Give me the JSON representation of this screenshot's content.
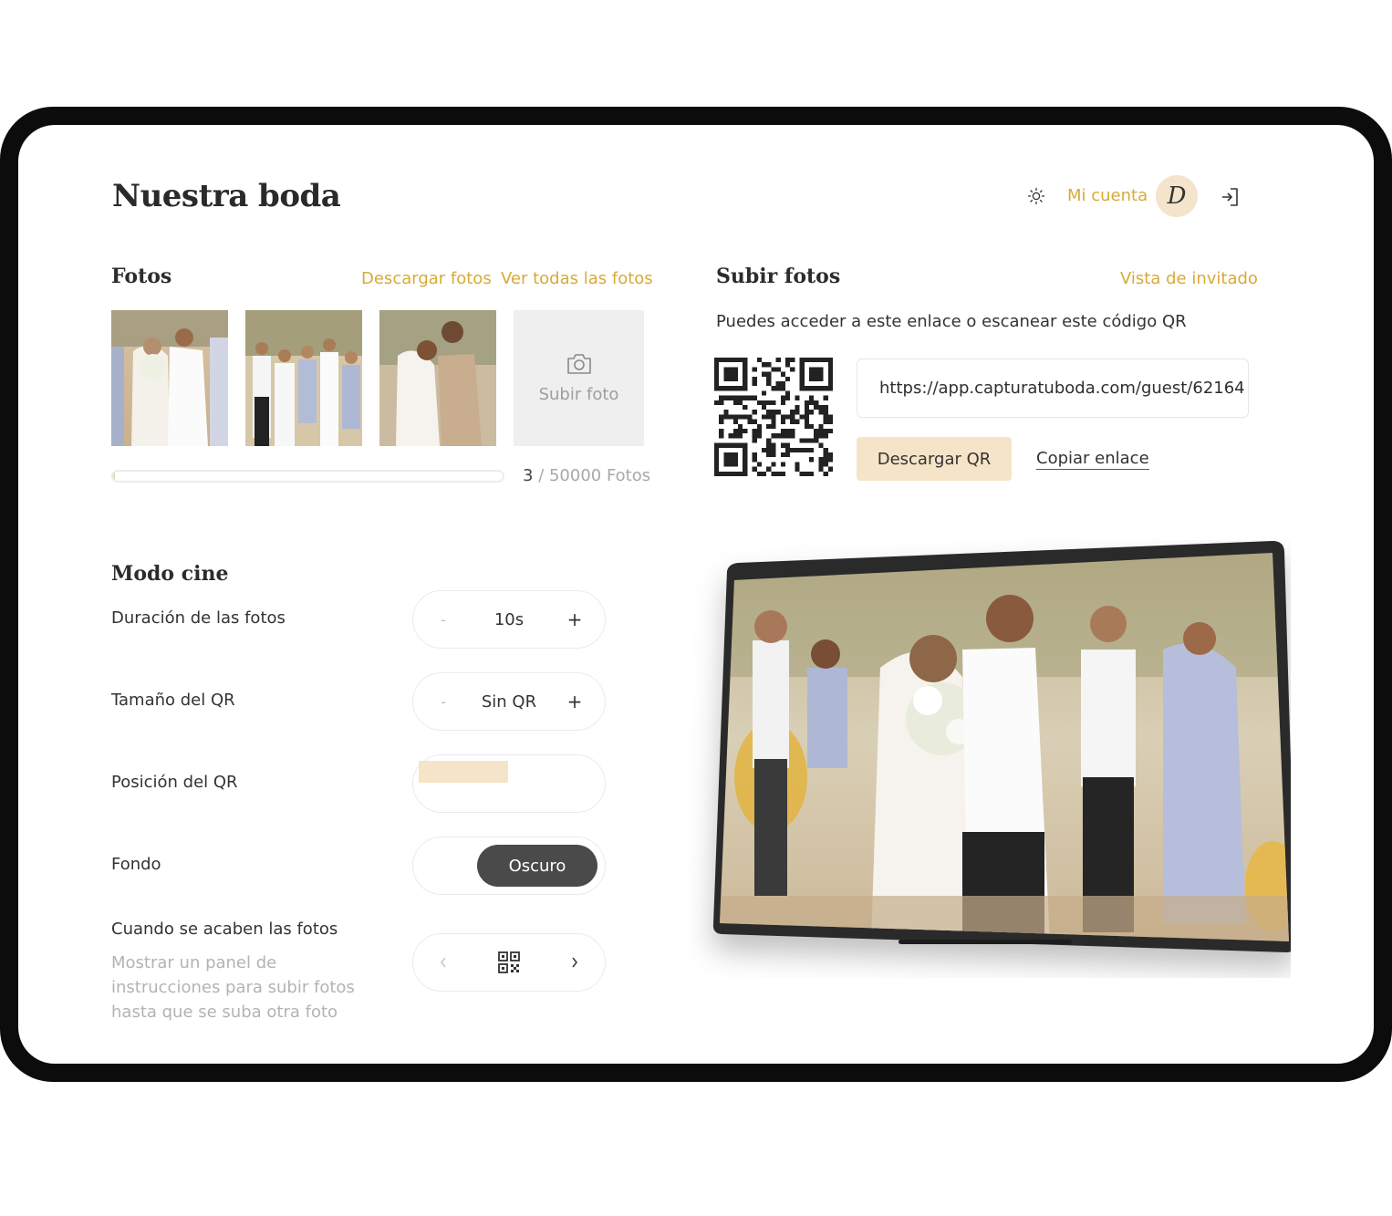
{
  "header": {
    "title": "Nuestra boda",
    "account_label": "Mi cuenta",
    "avatar_initial": "D"
  },
  "photos": {
    "heading": "Fotos",
    "download_label": "Descargar fotos",
    "view_all_label": "Ver todas las fotos",
    "upload_label": "Subir foto",
    "count_current": "3",
    "count_total": "/ 50000 Fotos",
    "progress_fraction": 6e-05
  },
  "upload": {
    "heading": "Subir fotos",
    "guest_view_label": "Vista de invitado",
    "description": "Puedes acceder a este enlace o escanear este código QR",
    "url": "https://app.capturatuboda.com/guest/62164",
    "download_qr_label": "Descargar QR",
    "copy_link_label": "Copiar enlace"
  },
  "cinema": {
    "heading": "Modo cine",
    "duration_label": "Duración de las fotos",
    "duration_value": "10s",
    "qr_size_label": "Tamaño del QR",
    "qr_size_value": "Sin QR",
    "qr_position_label": "Posición del QR",
    "background_label": "Fondo",
    "background_value": "Oscuro",
    "end_label": "Cuando se acaben las fotos",
    "end_description": "Mostrar un panel de instrucciones para subir fotos hasta que se suba otra foto",
    "minus_symbol": "-",
    "plus_symbol": "+"
  },
  "colors": {
    "accent_gold": "#d8aa36",
    "accent_cream": "#f6e4c8",
    "dark_pill": "#4a4a4a",
    "device_frame": "#0c0c0c"
  },
  "icons": [
    "sun-icon",
    "logout-icon",
    "camera-icon",
    "qr-code-icon",
    "chevron-left-icon",
    "chevron-right-icon"
  ]
}
